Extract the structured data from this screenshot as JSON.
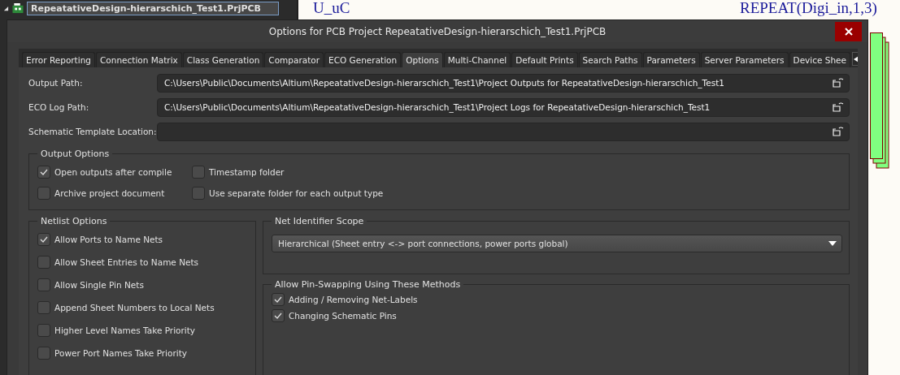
{
  "project_tree": {
    "items": [
      {
        "label": "RepeatativeDesign-hierarschich_Test1.PrjPCB",
        "selected": true,
        "expanded": true
      }
    ]
  },
  "schematic": {
    "labels": [
      "U_uC",
      "REPEAT(Digi_in,1,3)"
    ]
  },
  "dialog": {
    "title": "Options for PCB Project RepeatativeDesign-hierarschich_Test1.PrjPCB",
    "tabs": [
      {
        "label": "Error Reporting",
        "selected": false
      },
      {
        "label": "Connection Matrix",
        "selected": false
      },
      {
        "label": "Class Generation",
        "selected": false
      },
      {
        "label": "Comparator",
        "selected": false
      },
      {
        "label": "ECO Generation",
        "selected": false
      },
      {
        "label": "Options",
        "selected": true
      },
      {
        "label": "Multi-Channel",
        "selected": false
      },
      {
        "label": "Default Prints",
        "selected": false
      },
      {
        "label": "Search Paths",
        "selected": false
      },
      {
        "label": "Parameters",
        "selected": false
      },
      {
        "label": "Server Parameters",
        "selected": false
      },
      {
        "label": "Device Shee",
        "selected": false
      }
    ],
    "paths": [
      {
        "label": "Output Path:",
        "value": "C:\\Users\\Public\\Documents\\Altium\\RepeatativeDesign-hierarschich_Test1\\Project Outputs for RepeatativeDesign-hierarschich_Test1"
      },
      {
        "label": "ECO Log Path:",
        "value": "C:\\Users\\Public\\Documents\\Altium\\RepeatativeDesign-hierarschich_Test1\\Project Logs for RepeatativeDesign-hierarschich_Test1"
      },
      {
        "label": "Schematic Template Location:"
      }
    ],
    "output_options": {
      "title": "Output Options",
      "options": [
        {
          "label": "Open outputs after compile",
          "checked": true
        },
        {
          "label": "Timestamp folder",
          "checked": false
        },
        {
          "label": "Archive project document",
          "checked": false
        },
        {
          "label": "Use separate folder for each output type",
          "checked": false
        }
      ]
    },
    "netlist_options": {
      "title": "Netlist Options",
      "options": [
        {
          "label": "Allow Ports to Name Nets",
          "checked": true
        },
        {
          "label": "Allow Sheet Entries to Name Nets",
          "checked": false
        },
        {
          "label": "Allow Single Pin Nets",
          "checked": false
        },
        {
          "label": "Append Sheet Numbers to Local Nets",
          "checked": false
        },
        {
          "label": "Higher Level Names Take Priority",
          "checked": false
        },
        {
          "label": "Power Port Names Take Priority",
          "checked": false
        }
      ]
    },
    "net_identifier_scope": {
      "title": "Net Identifier Scope",
      "value": "Hierarchical (Sheet entry <-> port connections, power ports global)"
    },
    "pin_swapping": {
      "title": "Allow Pin-Swapping Using These Methods",
      "options": [
        {
          "label": "Adding / Removing Net-Labels",
          "checked": true
        },
        {
          "label": "Changing Schematic Pins",
          "checked": true
        }
      ]
    }
  }
}
